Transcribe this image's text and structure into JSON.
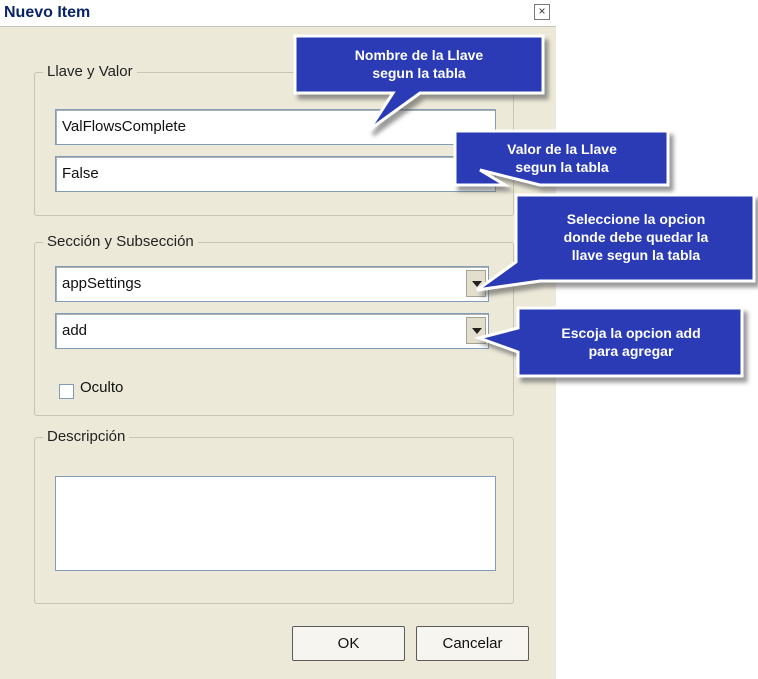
{
  "window": {
    "title": "Nuevo Item",
    "close_glyph": "×"
  },
  "groups": {
    "key_value": {
      "label": "Llave y Valor",
      "key_field_value": "ValFlowsComplete",
      "value_field_value": "False"
    },
    "section": {
      "label": "Sección y Subsección",
      "section_value": "appSettings",
      "subsection_value": "add",
      "hidden_checkbox_label": "Oculto",
      "hidden_checked": false
    },
    "description": {
      "label": "Descripción",
      "value": ""
    }
  },
  "buttons": {
    "ok": "OK",
    "cancel": "Cancelar"
  },
  "callouts": {
    "key_name": "Nombre de la Llave\nsegun la tabla",
    "key_value": "Valor de la Llave\nsegun la tabla",
    "section": "Seleccione la opcion\ndonde debe quedar la\nllave segun la tabla",
    "add": "Escoja la opcion add\npara agregar"
  },
  "colors": {
    "callout_fill": "#2b3bb5",
    "callout_border": "#ffffff",
    "dialog_bg": "#ece9d8"
  }
}
